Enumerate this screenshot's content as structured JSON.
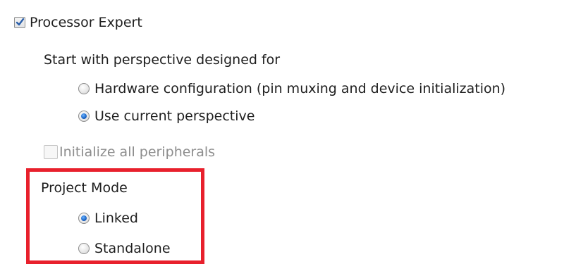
{
  "processor_expert": {
    "label": "Processor Expert",
    "checked": true
  },
  "perspective": {
    "heading": "Start with perspective designed for",
    "options": [
      {
        "label": "Hardware configuration (pin muxing and device initialization)",
        "selected": false
      },
      {
        "label": "Use current perspective",
        "selected": true
      }
    ]
  },
  "initialize_peripherals": {
    "label": "Initialize all peripherals",
    "checked": false,
    "enabled": false
  },
  "project_mode": {
    "heading": "Project Mode",
    "options": [
      {
        "label": "Linked",
        "selected": true
      },
      {
        "label": "Standalone",
        "selected": false
      }
    ]
  },
  "colors": {
    "highlight_border": "#e8202c",
    "radio_selected": "#1a63c4",
    "disabled_text": "#8d8d8d"
  },
  "icons": {
    "check": "check-icon"
  }
}
